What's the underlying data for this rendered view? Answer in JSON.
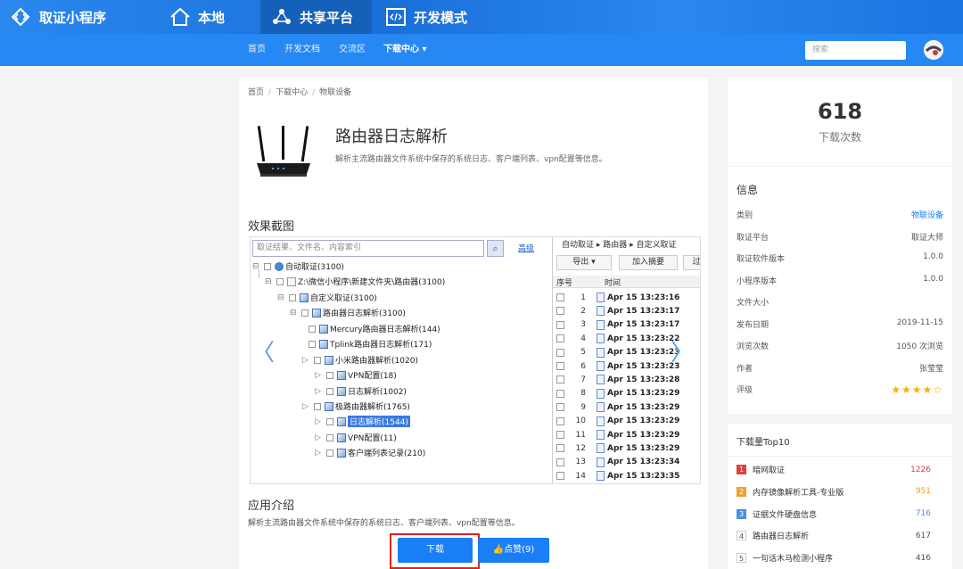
{
  "topnav": {
    "brand": "取证小程序",
    "items": [
      "本地",
      "共享平台",
      "开发模式"
    ]
  },
  "subnav": {
    "items": [
      "首页",
      "开发文档",
      "交流区"
    ],
    "current": "下载中心 ▾"
  },
  "search": {
    "placeholder": "搜索"
  },
  "breadcrumb": [
    "首页",
    "下载中心",
    "物联设备"
  ],
  "app": {
    "title": "路由器日志解析",
    "desc": "解析主流路由器文件系统中保存的系统日志、客户端列表、vpn配置等信息。"
  },
  "screenshot_section": {
    "title": "效果截图",
    "search_placeholder": "取证结果、文件名、内容索引",
    "advanced": "高级",
    "tree": [
      {
        "label": "自动取证(3100)"
      },
      {
        "label": "Z:\\微信小程序\\新建文件夹\\路由器(3100)"
      },
      {
        "label": "自定义取证(3100)"
      },
      {
        "label": "路由器日志解析(3100)"
      },
      {
        "label": "Mercury路由器日志解析(144)"
      },
      {
        "label": "Tplink路由器日志解析(171)"
      },
      {
        "label": "小米路由器解析(1020)"
      },
      {
        "label": "VPN配置(18)"
      },
      {
        "label": "日志解析(1002)"
      },
      {
        "label": "极路由器解析(1765)"
      },
      {
        "label": "日志解析(1544)"
      },
      {
        "label": "VPN配置(11)"
      },
      {
        "label": "客户端列表记录(210)"
      }
    ],
    "right_breadcrumb": "自动取证 ▸ 路由器 ▸ 自定义取证",
    "toolbar": {
      "export": "导出",
      "add": "加入摘要",
      "more": "过"
    },
    "columns": {
      "idx": "序号",
      "time": "时间"
    },
    "rows": [
      {
        "n": "1",
        "t": "Apr 15 13:23:16"
      },
      {
        "n": "2",
        "t": "Apr 15 13:23:17"
      },
      {
        "n": "3",
        "t": "Apr 15 13:23:17"
      },
      {
        "n": "4",
        "t": "Apr 15 13:23:22"
      },
      {
        "n": "5",
        "t": "Apr 15 13:23:23"
      },
      {
        "n": "6",
        "t": "Apr 15 13:23:23"
      },
      {
        "n": "7",
        "t": "Apr 15 13:23:28"
      },
      {
        "n": "8",
        "t": "Apr 15 13:23:29"
      },
      {
        "n": "9",
        "t": "Apr 15 13:23:29"
      },
      {
        "n": "10",
        "t": "Apr 15 13:23:29"
      },
      {
        "n": "11",
        "t": "Apr 15 13:23:29"
      },
      {
        "n": "12",
        "t": "Apr 15 13:23:29"
      },
      {
        "n": "13",
        "t": "Apr 15 13:23:34"
      },
      {
        "n": "14",
        "t": "Apr 15 13:23:35"
      }
    ]
  },
  "intro": {
    "title": "应用介绍",
    "text": "解析主流路由器文件系统中保存的系统日志、客户端列表、vpn配置等信息。"
  },
  "buttons": {
    "download": "下载",
    "like": "👍点赞(9)"
  },
  "stats": {
    "count": "618",
    "label": "下载次数"
  },
  "info": {
    "title": "信息",
    "rows": [
      {
        "k": "类别",
        "v": "物联设备"
      },
      {
        "k": "取证平台",
        "v": "取证大师"
      },
      {
        "k": "取证软件版本",
        "v": "1.0.0"
      },
      {
        "k": "小程序版本",
        "v": "1.0.0"
      },
      {
        "k": "文件大小",
        "v": ""
      },
      {
        "k": "发布日期",
        "v": "2019-11-15"
      },
      {
        "k": "浏览次数",
        "v": "1050 次浏览"
      },
      {
        "k": "作者",
        "v": "张莹莹"
      },
      {
        "k": "评级",
        "v": "★★★★☆"
      }
    ],
    "rating": 4,
    "link_color": "#1a7ef5"
  },
  "top10": {
    "title": "下载量Top10",
    "items": [
      {
        "rank": "1",
        "name": "暗网取证",
        "count": "1226",
        "color": "#e04040"
      },
      {
        "rank": "2",
        "name": "内存镜像解析工具-专业版",
        "count": "951",
        "color": "#f0a030"
      },
      {
        "rank": "3",
        "name": "证据文件硬盘信息",
        "count": "716",
        "color": "#4a8fe0"
      },
      {
        "rank": "4",
        "name": "路由器日志解析",
        "count": "617",
        "color": "#ffffff"
      },
      {
        "rank": "5",
        "name": "一句话木马检测小程序",
        "count": "416",
        "color": "#ffffff"
      }
    ]
  }
}
